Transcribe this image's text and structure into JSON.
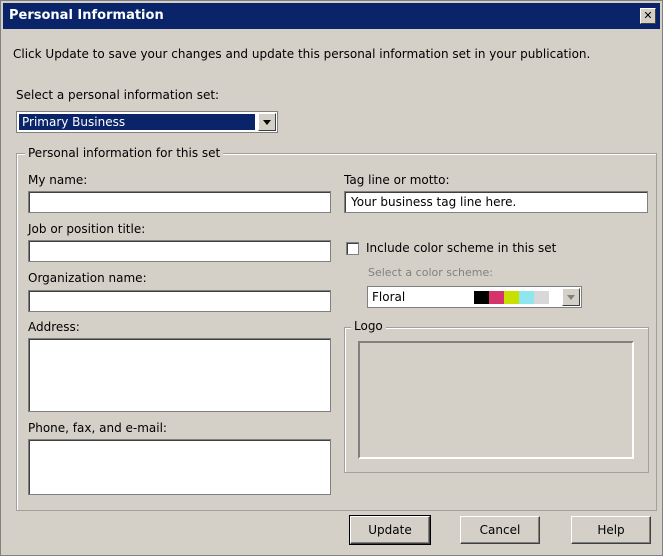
{
  "window": {
    "title": "Personal Information",
    "close_label": "✕"
  },
  "instructions": "Click Update to save your changes and update this personal information set in your publication.",
  "set_select": {
    "label": "Select a personal information set:",
    "value": "Primary Business"
  },
  "group": {
    "legend": "Personal information for this set",
    "my_name": {
      "label": "My name:",
      "value": ""
    },
    "job_title": {
      "label": "Job or position title:",
      "value": ""
    },
    "organization": {
      "label": "Organization name:",
      "value": ""
    },
    "address": {
      "label": "Address:",
      "value": ""
    },
    "phone": {
      "label": "Phone, fax, and e-mail:",
      "value": ""
    },
    "tagline": {
      "label": "Tag line or motto:",
      "value": "Your business tag line here."
    },
    "color_scheme_checkbox": {
      "label": "Include color scheme in this set",
      "checked": false
    },
    "color_scheme_select": {
      "label": "Select a color scheme:",
      "value": "Floral",
      "swatches": [
        "#000000",
        "#d6336c",
        "#c8e000",
        "#8fe6ee",
        "#d8d8d8"
      ]
    },
    "logo": {
      "legend": "Logo"
    }
  },
  "buttons": {
    "update": "Update",
    "cancel": "Cancel",
    "help": "Help"
  }
}
